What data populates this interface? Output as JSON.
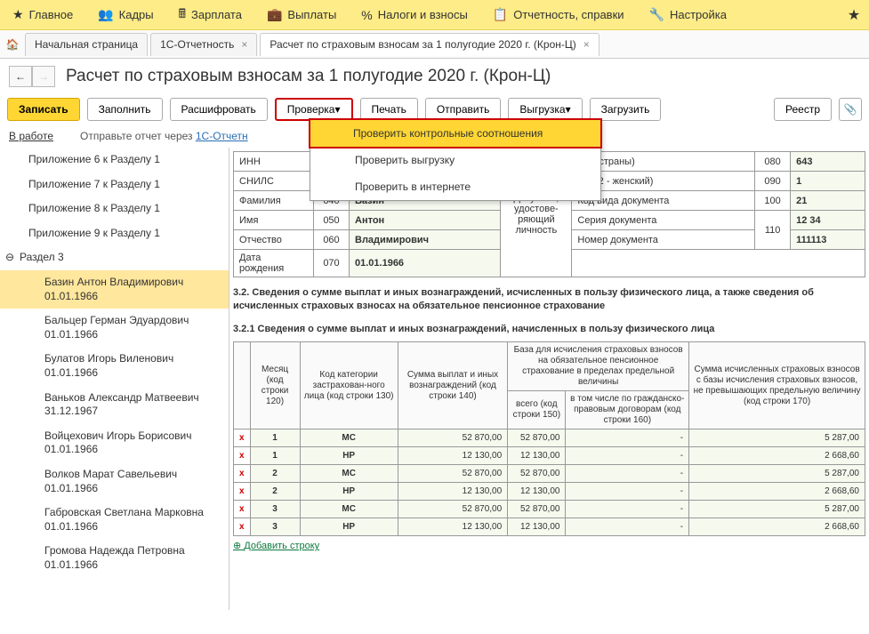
{
  "top_menu": [
    {
      "icon": "★",
      "label": "Главное"
    },
    {
      "icon": "👥",
      "label": "Кадры"
    },
    {
      "icon": "🖩",
      "label": "Зарплата"
    },
    {
      "icon": "💼",
      "label": "Выплаты"
    },
    {
      "icon": "%",
      "label": "Налоги и взносы"
    },
    {
      "icon": "📋",
      "label": "Отчетность, справки"
    },
    {
      "icon": "🔧",
      "label": "Настройка"
    }
  ],
  "tabs": [
    {
      "label": "Начальная страница",
      "closable": false
    },
    {
      "label": "1С-Отчетность",
      "closable": true
    },
    {
      "label": "Расчет по страховым взносам за 1 полугодие 2020 г. (Крон-Ц)",
      "closable": true,
      "active": true
    }
  ],
  "page_title": "Расчет по страховым взносам за 1 полугодие 2020 г. (Крон-Ц)",
  "toolbar": {
    "write": "Записать",
    "fill": "Заполнить",
    "decode": "Расшифровать",
    "check": "Проверка",
    "print": "Печать",
    "send": "Отправить",
    "export": "Выгрузка",
    "load": "Загрузить",
    "registry": "Реестр"
  },
  "check_menu": [
    "Проверить контрольные соотношения",
    "Проверить выгрузку",
    "Проверить в интернете"
  ],
  "status": {
    "link": "В работе",
    "text": "Отправьте отчет через ",
    "text_link": "1С-Отчетн"
  },
  "sidebar": [
    "Приложение 6 к Разделу 1",
    "Приложение 7 к Разделу 1",
    "Приложение 8 к Разделу 1",
    "Приложение 9 к Разделу 1"
  ],
  "sidebar_section": "Раздел 3",
  "sidebar_people": [
    "Базин Антон Владимирович 01.01.1966",
    "Бальцер Герман Эдуардович 01.01.1966",
    "Булатов Игорь Виленович 01.01.1966",
    "Ваньков Александр Матвеевич 31.12.1967",
    "Войцехович Игорь Борисович 01.01.1966",
    "Волков Марат Савельевич 01.01.1966",
    "Габровская Светлана Марковна 01.01.1966",
    "Громова Надежда Петровна 01.01.1966"
  ],
  "info": {
    "inn_lbl": "ИНН",
    "snils_lbl": "СНИЛС",
    "lastname_lbl": "Фамилия",
    "lastname_code": "040",
    "lastname": "Базин",
    "firstname_lbl": "Имя",
    "firstname_code": "050",
    "firstname": "Антон",
    "patronymic_lbl": "Отчество",
    "patronymic_code": "060",
    "patronymic": "Владимирович",
    "birthdate_lbl": "Дата рождения",
    "birthdate_code": "070",
    "birthdate": "01.01.1966",
    "doc_lbl": "Документ, удостове-ряющий личность",
    "country_lbl": "(код страны)",
    "country_code": "080",
    "country": "643",
    "gender_lbl": "кой; 2 - женский)",
    "gender_code": "090",
    "gender": "1",
    "doctype_lbl": "Код вида документа",
    "doctype_code": "100",
    "doctype": "21",
    "docseries_lbl": "Серия документа",
    "docseries": "12 34",
    "docnum_lbl": "Номер документа",
    "docnum_code": "110",
    "docnum": "111113"
  },
  "section_32": "3.2. Сведения о сумме выплат и иных вознаграждений, исчисленных в пользу физического лица, а также сведения об исчисленных страховых взносах на обязательное пенсионное страхование",
  "section_321": "3.2.1 Сведения о сумме выплат и иных вознаграждений, начисленных в пользу физического лица",
  "headers": {
    "month": "Месяц (код строки 120)",
    "category": "Код категории застрахован-ного лица (код строки 130)",
    "payments": "Сумма выплат и иных вознаграждений (код строки 140)",
    "base": "База для исчисления страховых взносов на обязательное пенсионное страхование в пределах предельной величины",
    "total": "всего (код строки 150)",
    "civil": "в том числе по гражданско-правовым договорам (код строки 160)",
    "calc": "Сумма исчисленных страховых взносов с базы исчисления страховых взносов, не превышающих предельную величину (код строки 170)"
  },
  "rows": [
    {
      "m": "1",
      "cat": "МС",
      "pay": "52 870,00",
      "tot": "52 870,00",
      "civ": "-",
      "calc": "5 287,00"
    },
    {
      "m": "1",
      "cat": "НР",
      "pay": "12 130,00",
      "tot": "12 130,00",
      "civ": "-",
      "calc": "2 668,60"
    },
    {
      "m": "2",
      "cat": "МС",
      "pay": "52 870,00",
      "tot": "52 870,00",
      "civ": "-",
      "calc": "5 287,00"
    },
    {
      "m": "2",
      "cat": "НР",
      "pay": "12 130,00",
      "tot": "12 130,00",
      "civ": "-",
      "calc": "2 668,60"
    },
    {
      "m": "3",
      "cat": "МС",
      "pay": "52 870,00",
      "tot": "52 870,00",
      "civ": "-",
      "calc": "5 287,00"
    },
    {
      "m": "3",
      "cat": "НР",
      "pay": "12 130,00",
      "tot": "12 130,00",
      "civ": "-",
      "calc": "2 668,60"
    }
  ],
  "add_row": "Добавить строку"
}
